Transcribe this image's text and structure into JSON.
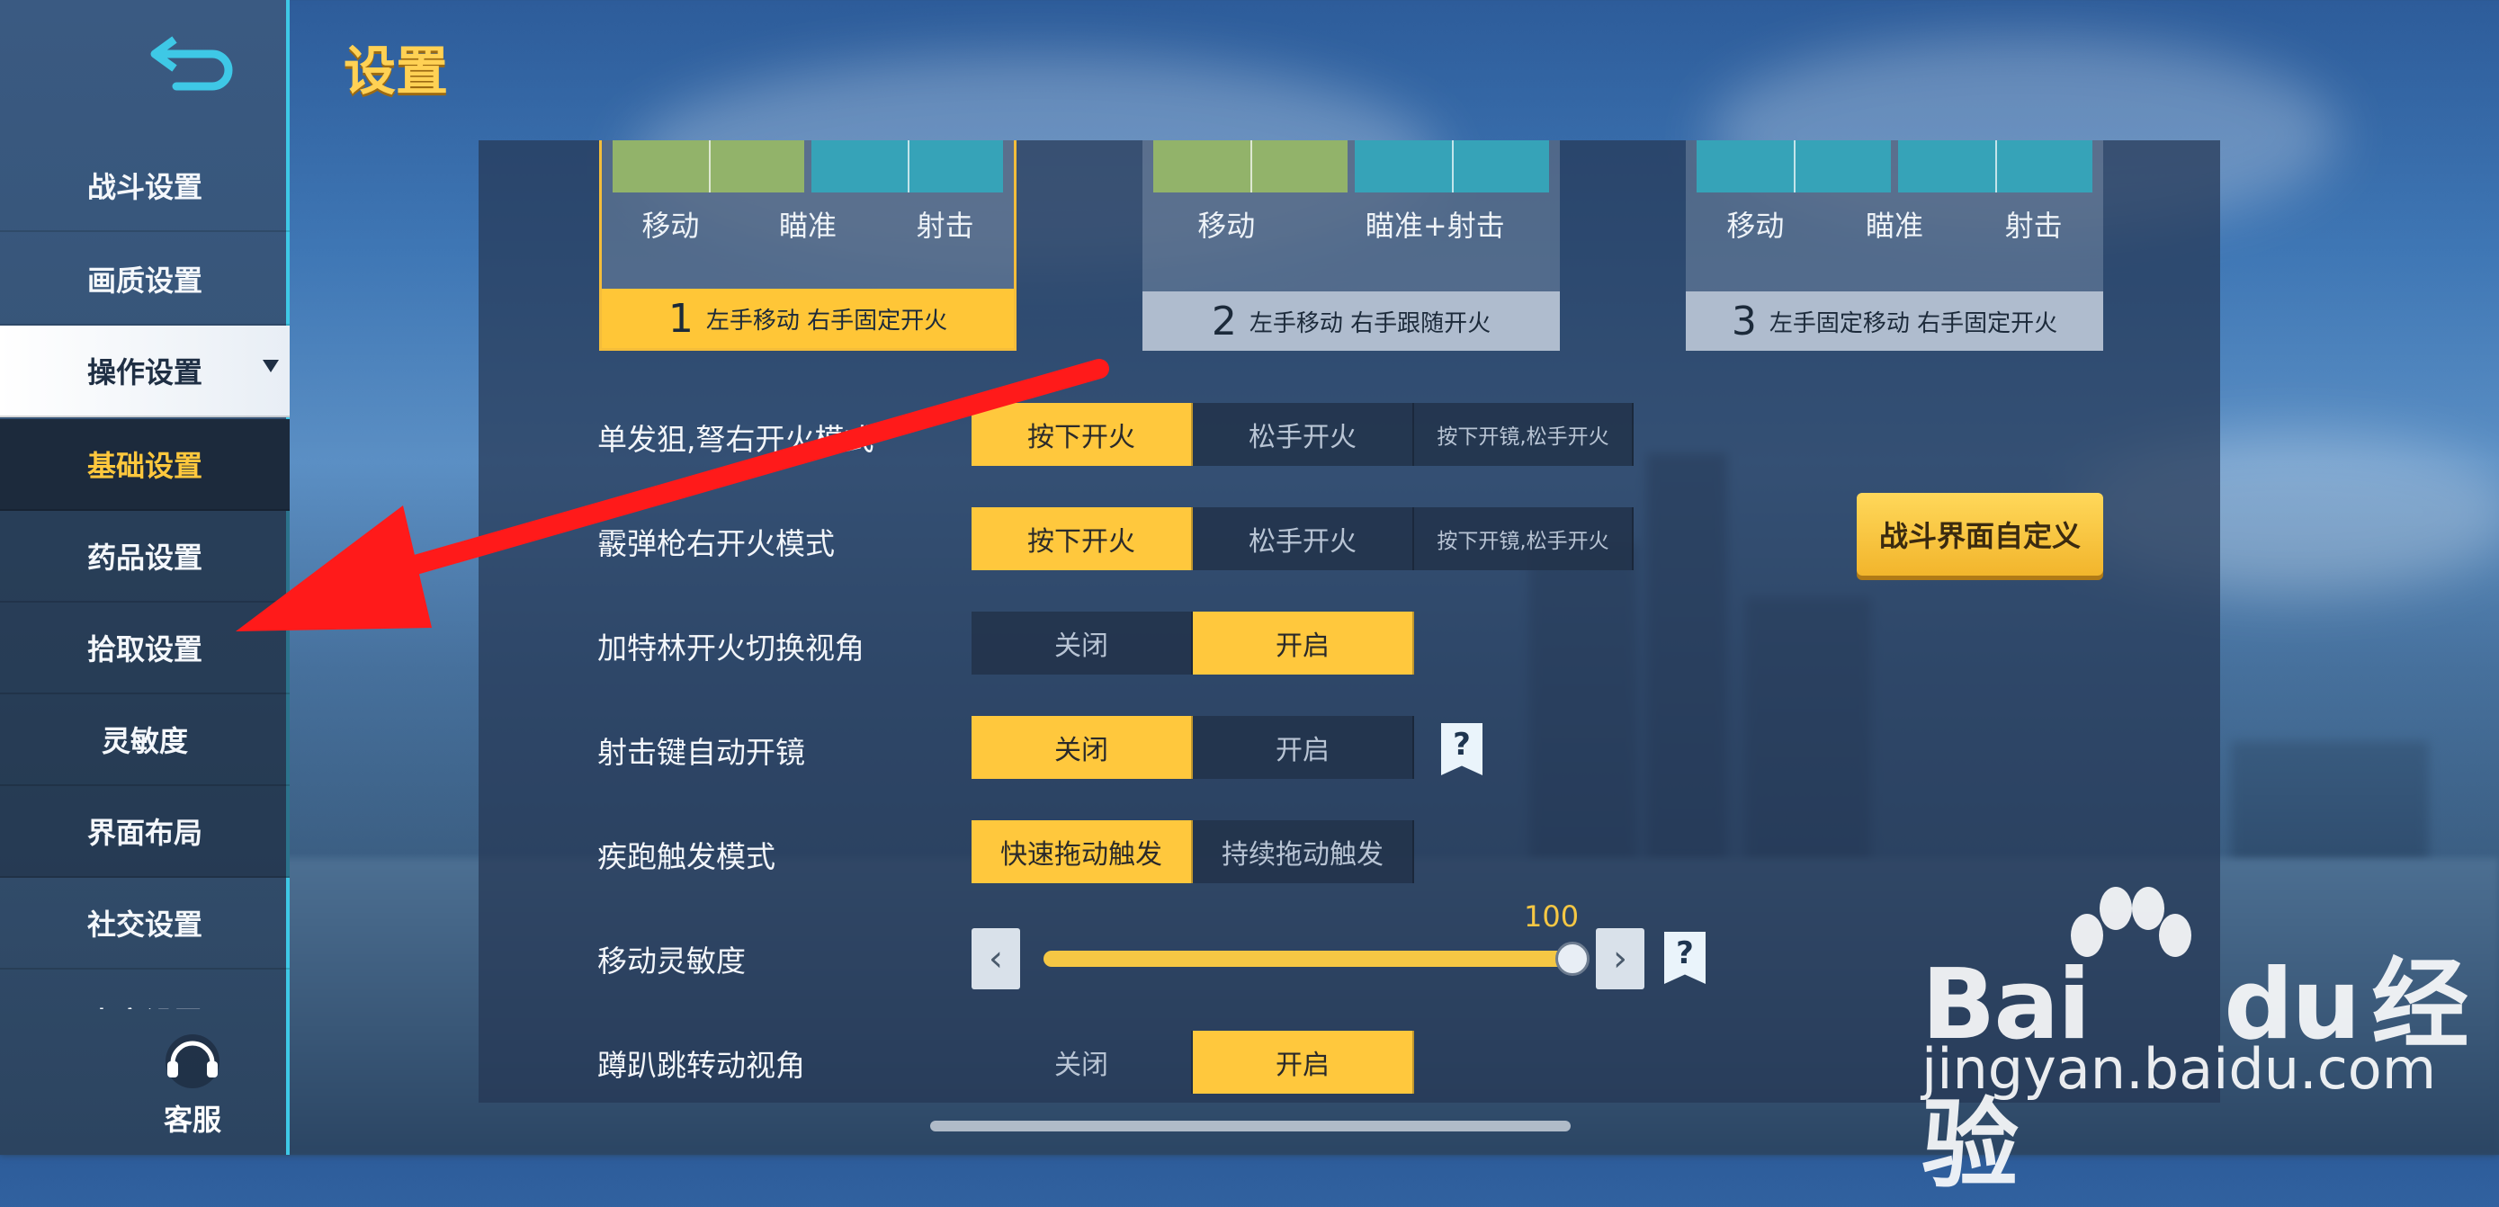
{
  "title": "设置",
  "sidebar": {
    "items": [
      {
        "label": "战斗设置"
      },
      {
        "label": "画质设置"
      },
      {
        "label": "操作设置"
      },
      {
        "label": "基础设置"
      },
      {
        "label": "药品设置"
      },
      {
        "label": "拾取设置"
      },
      {
        "label": "灵敏度"
      },
      {
        "label": "界面布局"
      },
      {
        "label": "社交设置"
      },
      {
        "label": "声音设置"
      }
    ],
    "service_label": "客服"
  },
  "modes": [
    {
      "num": "1",
      "caption": "左手移动 右手固定开火",
      "labels": [
        "移动",
        "瞄准",
        "射击"
      ],
      "selected": true
    },
    {
      "num": "2",
      "caption": "左手移动 右手跟随开火",
      "labels": [
        "移动",
        "瞄准+射击"
      ],
      "selected": false
    },
    {
      "num": "3",
      "caption": "左手固定移动 右手固定开火",
      "labels": [
        "移动",
        "瞄准",
        "射击"
      ],
      "selected": false
    }
  ],
  "rows": [
    {
      "label": "单发狙,弩右开火模式",
      "options": [
        "按下开火",
        "松手开火",
        "按下开镜,松手开火"
      ],
      "selected": 0
    },
    {
      "label": "霰弹枪右开火模式",
      "options": [
        "按下开火",
        "松手开火",
        "按下开镜,松手开火"
      ],
      "selected": 0
    },
    {
      "label": "加特林开火切换视角",
      "options": [
        "关闭",
        "开启"
      ],
      "selected": 1
    },
    {
      "label": "射击键自动开镜",
      "options": [
        "关闭",
        "开启"
      ],
      "selected": 0
    },
    {
      "label": "疾跑触发模式",
      "options": [
        "快速拖动触发",
        "持续拖动触发"
      ],
      "selected": 0
    },
    {
      "label": "移动灵敏度"
    },
    {
      "label": "蹲趴跳转动视角",
      "options": [
        "关闭",
        "开启"
      ],
      "selected": 1
    }
  ],
  "custom_button": "战斗界面自定义",
  "slider": {
    "value": "100",
    "fraction": 1.0
  },
  "help_glyph": "?",
  "watermark": {
    "brand": "Bai",
    "brand2": "du",
    "cn": "经验",
    "url": "jingyan.baidu.com"
  },
  "colors": {
    "accent": "#ffc83d",
    "annotation_arrow": "#ff1a1a",
    "sidebar_border": "#3ec8e6"
  }
}
